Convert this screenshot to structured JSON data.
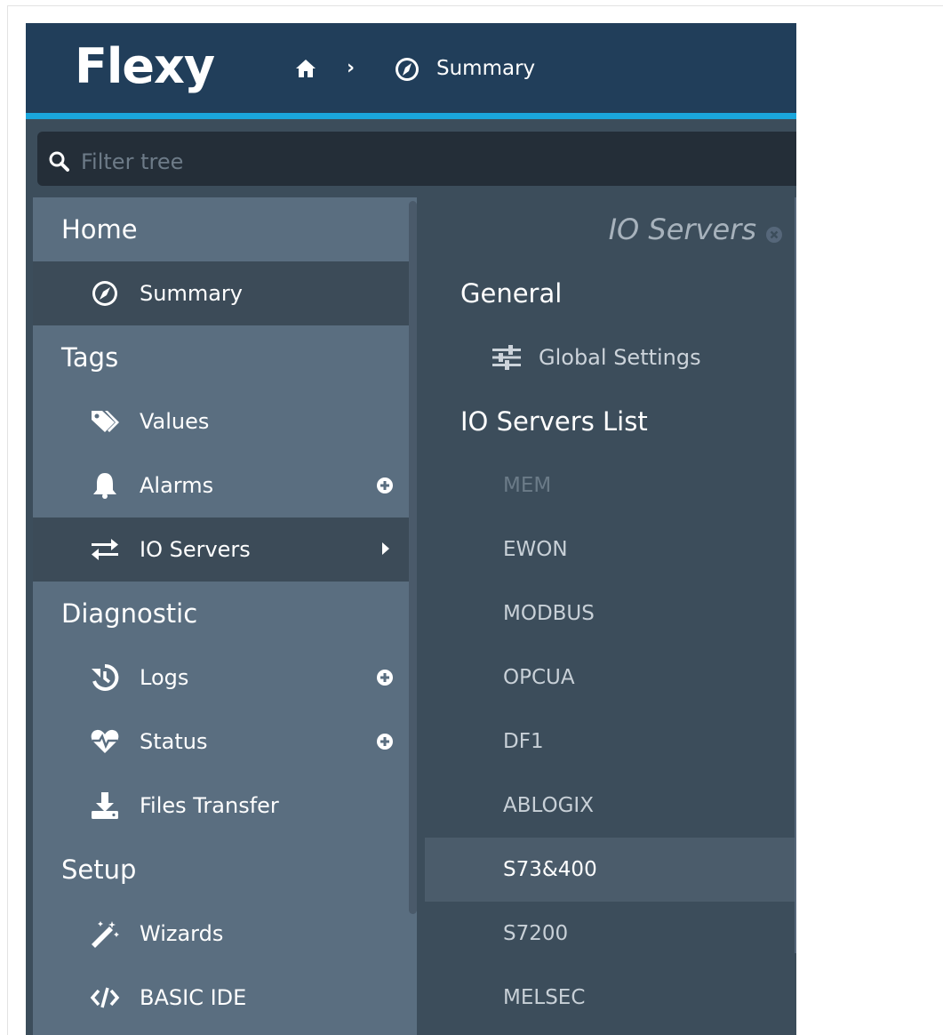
{
  "header": {
    "logo": "Flexy",
    "breadcrumb": {
      "current": "Summary"
    }
  },
  "filter": {
    "placeholder": "Filter tree",
    "value": ""
  },
  "tree": {
    "sections": {
      "home": "Home",
      "tags": "Tags",
      "diagnostic": "Diagnostic",
      "setup": "Setup"
    },
    "items": {
      "summary": "Summary",
      "values": "Values",
      "alarms": "Alarms",
      "io_servers": "IO Servers",
      "logs": "Logs",
      "status": "Status",
      "files_transfer": "Files Transfer",
      "wizards": "Wizards",
      "basic_ide": "BASIC IDE"
    }
  },
  "io_panel": {
    "title": "IO Servers",
    "general_heading": "General",
    "global_settings": "Global Settings",
    "list_heading": "IO Servers List",
    "servers": [
      "MEM",
      "EWON",
      "MODBUS",
      "OPCUA",
      "DF1",
      "ABLOGIX",
      "S73&400",
      "S7200",
      "MELSEC"
    ],
    "selected_server": "S73&400",
    "disabled_server": "MEM"
  },
  "colors": {
    "header_bg": "#213e5a",
    "accent": "#1aa6dc",
    "tree_bg": "#5a6e80",
    "active_row": "#3c4b58",
    "panel_bg": "#3c4d5b"
  },
  "icons": {
    "home": "home-icon",
    "summary": "compass-icon",
    "values": "tags-icon",
    "alarms": "bell-icon",
    "io_servers": "exchange-icon",
    "logs": "history-icon",
    "status": "heartbeat-icon",
    "files_transfer": "download-icon",
    "wizards": "magic-wand-icon",
    "basic_ide": "code-icon",
    "global_settings": "sliders-icon"
  }
}
